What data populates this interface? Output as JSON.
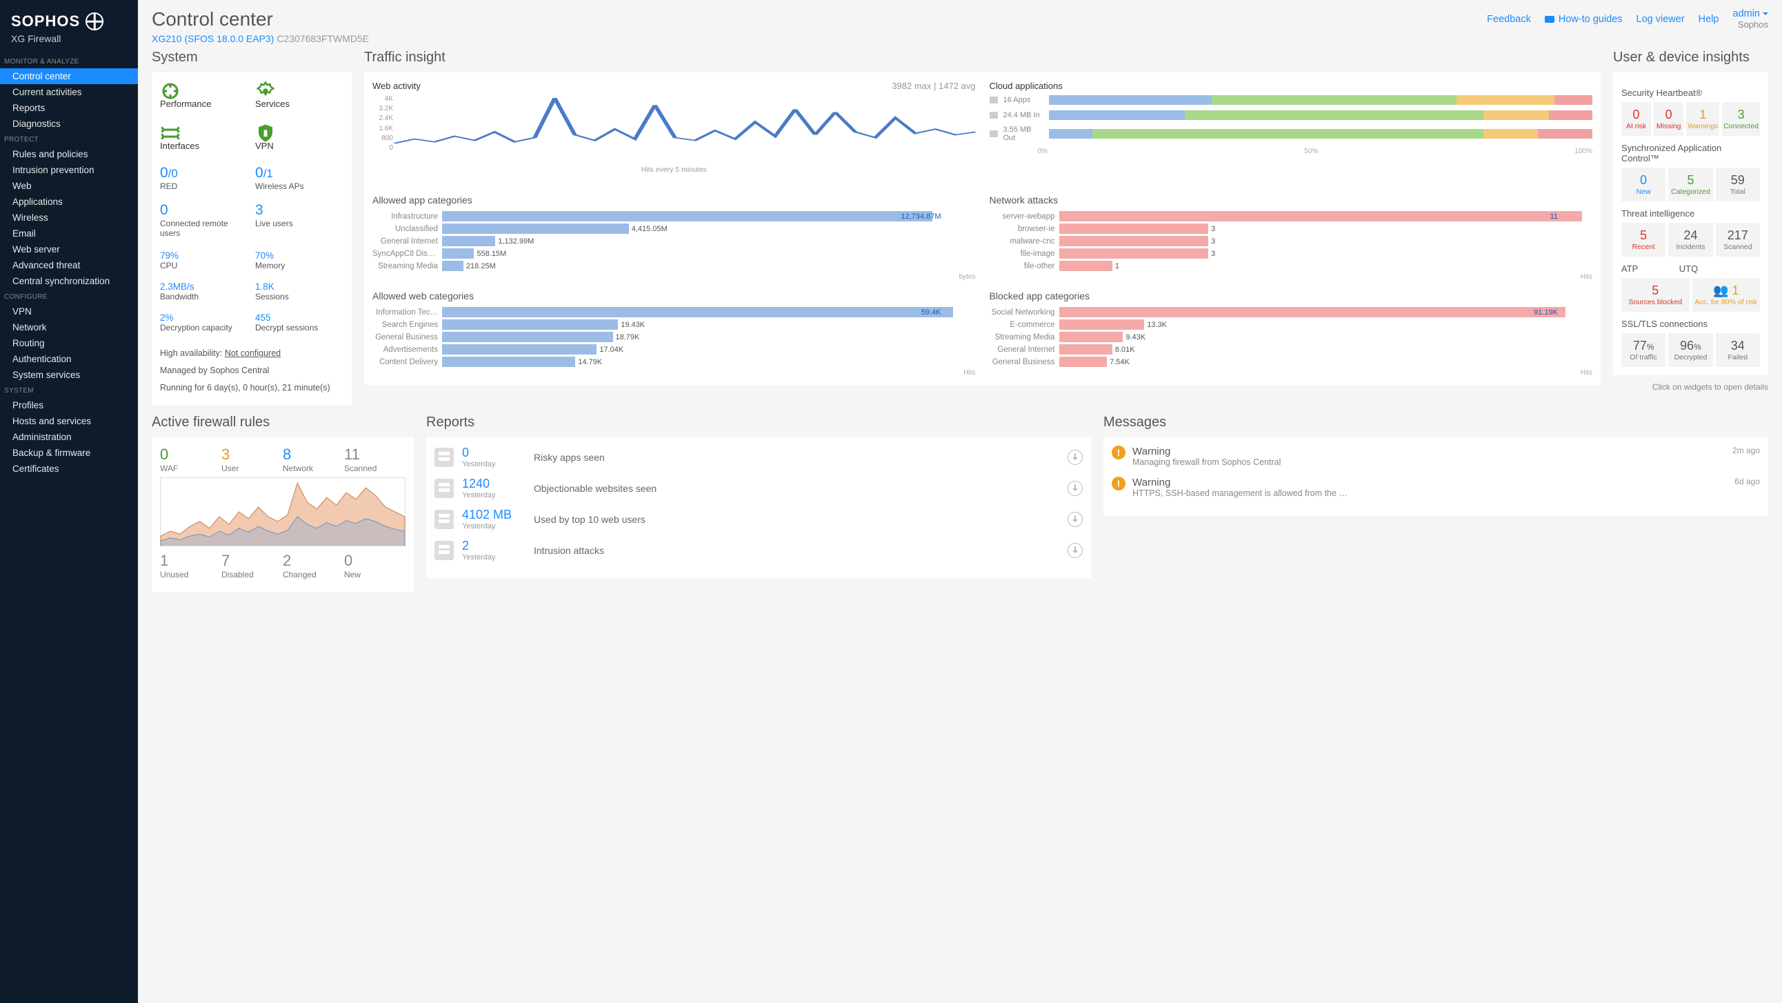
{
  "brand": {
    "name": "SOPHOS",
    "product": "XG Firewall"
  },
  "header": {
    "title": "Control center",
    "device_model": "XG210 (SFOS 18.0.0 EAP3)",
    "device_serial": "C2307683FTWMD5E",
    "links": {
      "feedback": "Feedback",
      "howto": "How-to guides",
      "logviewer": "Log viewer",
      "help": "Help"
    },
    "user": {
      "name": "admin",
      "company": "Sophos"
    }
  },
  "nav": {
    "groups": [
      {
        "label": "MONITOR & ANALYZE",
        "items": [
          "Control center",
          "Current activities",
          "Reports",
          "Diagnostics"
        ],
        "active": "Control center"
      },
      {
        "label": "PROTECT",
        "items": [
          "Rules and policies",
          "Intrusion prevention",
          "Web",
          "Applications",
          "Wireless",
          "Email",
          "Web server",
          "Advanced threat",
          "Central synchronization"
        ]
      },
      {
        "label": "CONFIGURE",
        "items": [
          "VPN",
          "Network",
          "Routing",
          "Authentication",
          "System services"
        ]
      },
      {
        "label": "SYSTEM",
        "items": [
          "Profiles",
          "Hosts and services",
          "Administration",
          "Backup & firmware",
          "Certificates"
        ]
      }
    ]
  },
  "system": {
    "title": "System",
    "icons": [
      {
        "label": "Performance"
      },
      {
        "label": "Services"
      },
      {
        "label": "Interfaces"
      },
      {
        "label": "VPN"
      }
    ],
    "metrics": [
      {
        "val": "0",
        "sub": "/0",
        "lbl": "RED"
      },
      {
        "val": "0",
        "sub": "/1",
        "lbl": "Wireless APs"
      },
      {
        "val": "0",
        "lbl": "Connected remote users"
      },
      {
        "val": "3",
        "lbl": "Live users"
      }
    ],
    "small_metrics": [
      {
        "val": "79%",
        "lbl": "CPU"
      },
      {
        "val": "70%",
        "lbl": "Memory"
      },
      {
        "val": "2.3MB/s",
        "lbl": "Bandwidth"
      },
      {
        "val": "1.8K",
        "lbl": "Sessions"
      },
      {
        "val": "2%",
        "lbl": "Decryption capacity"
      },
      {
        "val": "455",
        "lbl": "Decrypt sessions"
      }
    ],
    "ha_label": "High availability:",
    "ha_value": "Not configured",
    "managed": "Managed by Sophos Central",
    "uptime": "Running for 6 day(s), 0 hour(s), 21 minute(s)"
  },
  "traffic": {
    "title": "Traffic insight",
    "web_activity": {
      "label": "Web activity",
      "stats": "3982 max | 1472 avg",
      "ylabels": [
        "4K",
        "3.2K",
        "2.4K",
        "1.6K",
        "800",
        "0"
      ],
      "xaxis": "Hits every 5 minutes"
    },
    "cloud": {
      "title": "Cloud applications",
      "rows": [
        {
          "label": "16 Apps",
          "segs": [
            {
              "c": "#9bbce5",
              "w": 30
            },
            {
              "c": "#a8d88a",
              "w": 45
            },
            {
              "c": "#f5c97a",
              "w": 18
            },
            {
              "c": "#f0a0a0",
              "w": 7
            }
          ]
        },
        {
          "label": "24.4 MB In",
          "segs": [
            {
              "c": "#9bbce5",
              "w": 25
            },
            {
              "c": "#a8d88a",
              "w": 55
            },
            {
              "c": "#f5c97a",
              "w": 12
            },
            {
              "c": "#f0a0a0",
              "w": 8
            }
          ]
        },
        {
          "label": "3.55 MB Out",
          "segs": [
            {
              "c": "#9bbce5",
              "w": 8
            },
            {
              "c": "#a8d88a",
              "w": 72
            },
            {
              "c": "#f5c97a",
              "w": 10
            },
            {
              "c": "#f0a0a0",
              "w": 10
            }
          ]
        }
      ],
      "scale": [
        "0%",
        "50%",
        "100%"
      ]
    },
    "allowed_apps": {
      "title": "Allowed app categories",
      "unit": "bytes",
      "rows": [
        {
          "label": "Infrastructure",
          "val": "12,734.87M",
          "w": 100
        },
        {
          "label": "Unclassified",
          "val": "4,415.05M",
          "w": 35
        },
        {
          "label": "General Internet",
          "val": "1,132.99M",
          "w": 10
        },
        {
          "label": "SyncAppCtl Disc…",
          "val": "558.15M",
          "w": 6
        },
        {
          "label": "Streaming Media",
          "val": "218.25M",
          "w": 4
        }
      ]
    },
    "network_attacks": {
      "title": "Network attacks",
      "unit": "Hits",
      "rows": [
        {
          "label": "server-webapp",
          "val": "11",
          "w": 100
        },
        {
          "label": "browser-ie",
          "val": "3",
          "w": 28
        },
        {
          "label": "malware-cnc",
          "val": "3",
          "w": 28
        },
        {
          "label": "file-image",
          "val": "3",
          "w": 28
        },
        {
          "label": "file-other",
          "val": "1",
          "w": 10
        }
      ]
    },
    "allowed_web": {
      "title": "Allowed web categories",
      "unit": "Hits",
      "rows": [
        {
          "label": "Information Tec…",
          "val": "59.4K",
          "w": 100
        },
        {
          "label": "Search Engines",
          "val": "19.43K",
          "w": 33
        },
        {
          "label": "General Business",
          "val": "18.79K",
          "w": 32
        },
        {
          "label": "Advertisements",
          "val": "17.04K",
          "w": 29
        },
        {
          "label": "Content Delivery",
          "val": "14.79K",
          "w": 25
        }
      ]
    },
    "blocked_apps": {
      "title": "Blocked app categories",
      "unit": "Hits",
      "rows": [
        {
          "label": "Social Networking",
          "val": "91.19K",
          "w": 100
        },
        {
          "label": "E-commerce",
          "val": "13.3K",
          "w": 16
        },
        {
          "label": "Streaming Media",
          "val": "9.43K",
          "w": 12
        },
        {
          "label": "General Internet",
          "val": "8.01K",
          "w": 10
        },
        {
          "label": "General Business",
          "val": "7.54K",
          "w": 9
        }
      ]
    }
  },
  "insights": {
    "title": "User & device insights",
    "heartbeat": {
      "title": "Security Heartbeat®",
      "tiles": [
        {
          "n": "0",
          "l": "At risk",
          "c": "red"
        },
        {
          "n": "0",
          "l": "Missing",
          "c": "red"
        },
        {
          "n": "1",
          "l": "Warnings",
          "c": "orange"
        },
        {
          "n": "3",
          "l": "Connected",
          "c": "green"
        }
      ]
    },
    "sac": {
      "title": "Synchronized Application Control™",
      "tiles": [
        {
          "n": "0",
          "l": "New",
          "c": "blue"
        },
        {
          "n": "5",
          "l": "Categorized",
          "c": "green"
        },
        {
          "n": "59",
          "l": "Total",
          "c": "gray"
        }
      ]
    },
    "threat": {
      "title": "Threat intelligence",
      "tiles": [
        {
          "n": "5",
          "l": "Recent",
          "c": "red"
        },
        {
          "n": "24",
          "l": "Incidents",
          "c": "gray"
        },
        {
          "n": "217",
          "l": "Scanned",
          "c": "gray"
        }
      ]
    },
    "atp_utq": {
      "atp": "ATP",
      "utq": "UTQ",
      "tiles": [
        {
          "n": "5",
          "l": "Sources blocked",
          "c": "red"
        },
        {
          "n": "1",
          "l": "Acc. for 80% of risk",
          "c": "orange",
          "icon": true
        }
      ]
    },
    "ssl": {
      "title": "SSL/TLS connections",
      "tiles": [
        {
          "n": "77",
          "suf": "%",
          "l": "Of traffic",
          "c": "gray"
        },
        {
          "n": "96",
          "suf": "%",
          "l": "Decrypted",
          "c": "gray"
        },
        {
          "n": "34",
          "l": "Failed",
          "c": "gray"
        }
      ]
    },
    "hint": "Click on widgets to open details"
  },
  "firewall": {
    "title": "Active firewall rules",
    "top": [
      {
        "v": "0",
        "l": "WAF",
        "c": "green"
      },
      {
        "v": "3",
        "l": "User",
        "c": "orange"
      },
      {
        "v": "8",
        "l": "Network",
        "c": "blue"
      },
      {
        "v": "11",
        "l": "Scanned",
        "c": "gray"
      }
    ],
    "bottom": [
      {
        "v": "1",
        "l": "Unused",
        "c": "gray"
      },
      {
        "v": "7",
        "l": "Disabled",
        "c": "gray"
      },
      {
        "v": "2",
        "l": "Changed",
        "c": "gray"
      },
      {
        "v": "0",
        "l": "New",
        "c": "gray"
      }
    ]
  },
  "reports": {
    "title": "Reports",
    "rows": [
      {
        "n": "0",
        "s": "Yesterday",
        "l": "Risky apps seen"
      },
      {
        "n": "1240",
        "s": "Yesterday",
        "l": "Objectionable websites seen"
      },
      {
        "n": "4102 MB",
        "s": "Yesterday",
        "l": "Used by top 10 web users"
      },
      {
        "n": "2",
        "s": "Yesterday",
        "l": "Intrusion attacks"
      }
    ]
  },
  "messages": {
    "title": "Messages",
    "rows": [
      {
        "t": "Warning",
        "d": "Managing firewall from Sophos Central",
        "a": "2m ago"
      },
      {
        "t": "Warning",
        "d": "HTTPS, SSH-based management is allowed from the …",
        "a": "6d ago"
      }
    ]
  },
  "chart_data": [
    {
      "type": "line",
      "title": "Web activity",
      "ylabel": "Hits",
      "ylim": [
        0,
        4000
      ],
      "xlabel": "every 5 minutes",
      "values": [
        600,
        900,
        700,
        1100,
        800,
        1400,
        700,
        1000,
        3800,
        1200,
        800,
        1600,
        900,
        3300,
        1000,
        800,
        1500,
        900,
        2100,
        1100,
        3000,
        1200,
        2800,
        1400,
        1000,
        2400,
        1300,
        1600,
        1200,
        1400
      ]
    },
    {
      "type": "bar",
      "title": "Cloud applications (apps)",
      "categories": [
        "blue",
        "green",
        "orange",
        "red"
      ],
      "values": [
        30,
        45,
        18,
        7
      ],
      "ylabel": "%"
    },
    {
      "type": "bar",
      "title": "Allowed app categories",
      "categories": [
        "Infrastructure",
        "Unclassified",
        "General Internet",
        "SyncAppCtl Disc",
        "Streaming Media"
      ],
      "values": [
        12734.87,
        4415.05,
        1132.99,
        558.15,
        218.25
      ],
      "ylabel": "MB"
    },
    {
      "type": "bar",
      "title": "Network attacks",
      "categories": [
        "server-webapp",
        "browser-ie",
        "malware-cnc",
        "file-image",
        "file-other"
      ],
      "values": [
        11,
        3,
        3,
        3,
        1
      ],
      "ylabel": "Hits"
    },
    {
      "type": "bar",
      "title": "Allowed web categories",
      "categories": [
        "Information Tech",
        "Search Engines",
        "General Business",
        "Advertisements",
        "Content Delivery"
      ],
      "values": [
        59400,
        19430,
        18790,
        17040,
        14790
      ],
      "ylabel": "Hits"
    },
    {
      "type": "bar",
      "title": "Blocked app categories",
      "categories": [
        "Social Networking",
        "E-commerce",
        "Streaming Media",
        "General Internet",
        "General Business"
      ],
      "values": [
        91190,
        13300,
        9430,
        8010,
        7540
      ],
      "ylabel": "Hits"
    },
    {
      "type": "area",
      "title": "Active firewall rules traffic",
      "series": [
        {
          "name": "a",
          "values": [
            10,
            15,
            12,
            20,
            25,
            18,
            30,
            22,
            35,
            28,
            40,
            30,
            25,
            32,
            65,
            45,
            38,
            50,
            42,
            55,
            48,
            60,
            52,
            40,
            35,
            30
          ]
        },
        {
          "name": "b",
          "values": [
            5,
            8,
            6,
            10,
            12,
            9,
            15,
            11,
            18,
            14,
            20,
            15,
            12,
            16,
            30,
            22,
            18,
            24,
            20,
            26,
            23,
            28,
            25,
            20,
            17,
            15
          ]
        }
      ],
      "ylim": [
        0,
        70
      ]
    }
  ]
}
